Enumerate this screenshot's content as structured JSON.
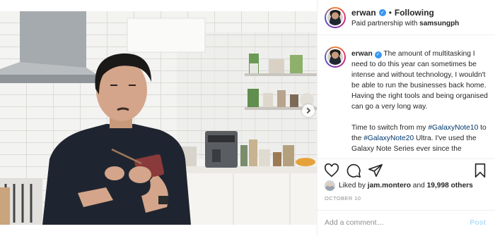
{
  "photo": {
    "alt_subject": "man using stylus on phone in kitchen"
  },
  "header": {
    "username": "erwan",
    "separator": "•",
    "follow_status": "Following",
    "partnership_prefix": "Paid partnership with",
    "partner": "samsungph"
  },
  "caption": {
    "username": "erwan",
    "paragraph1": "The amount of multitasking I need to do this year can sometimes be intense and without technology, I wouldn't be able to run the businesses back home. Having the right tools and being organised can go a very long way.",
    "p2_part1": "Time to switch from my ",
    "hashtag1": "#GalaxyNote10",
    "p2_part2": " to the ",
    "hashtag2": "#GalaxyNote20",
    "p2_part3": " Ultra. I've used the Galaxy Note Series ever since the"
  },
  "likes": {
    "prefix": "Liked by",
    "liker": "jam.montero",
    "conj": "and",
    "others": "19,998 others"
  },
  "date": "OCTOBER 10",
  "comment": {
    "placeholder": "Add a comment…",
    "post_label": "Post"
  },
  "icons": {
    "like": "heart-icon",
    "comment": "comment-bubble-icon",
    "share": "paper-plane-icon",
    "save": "bookmark-icon",
    "next": "chevron-right-icon",
    "verified": "verified-badge-icon"
  },
  "colors": {
    "verified_blue": "#3897f0",
    "hashtag": "#00376b",
    "muted": "#8e8e8e",
    "post_disabled": "#b2dffc"
  }
}
